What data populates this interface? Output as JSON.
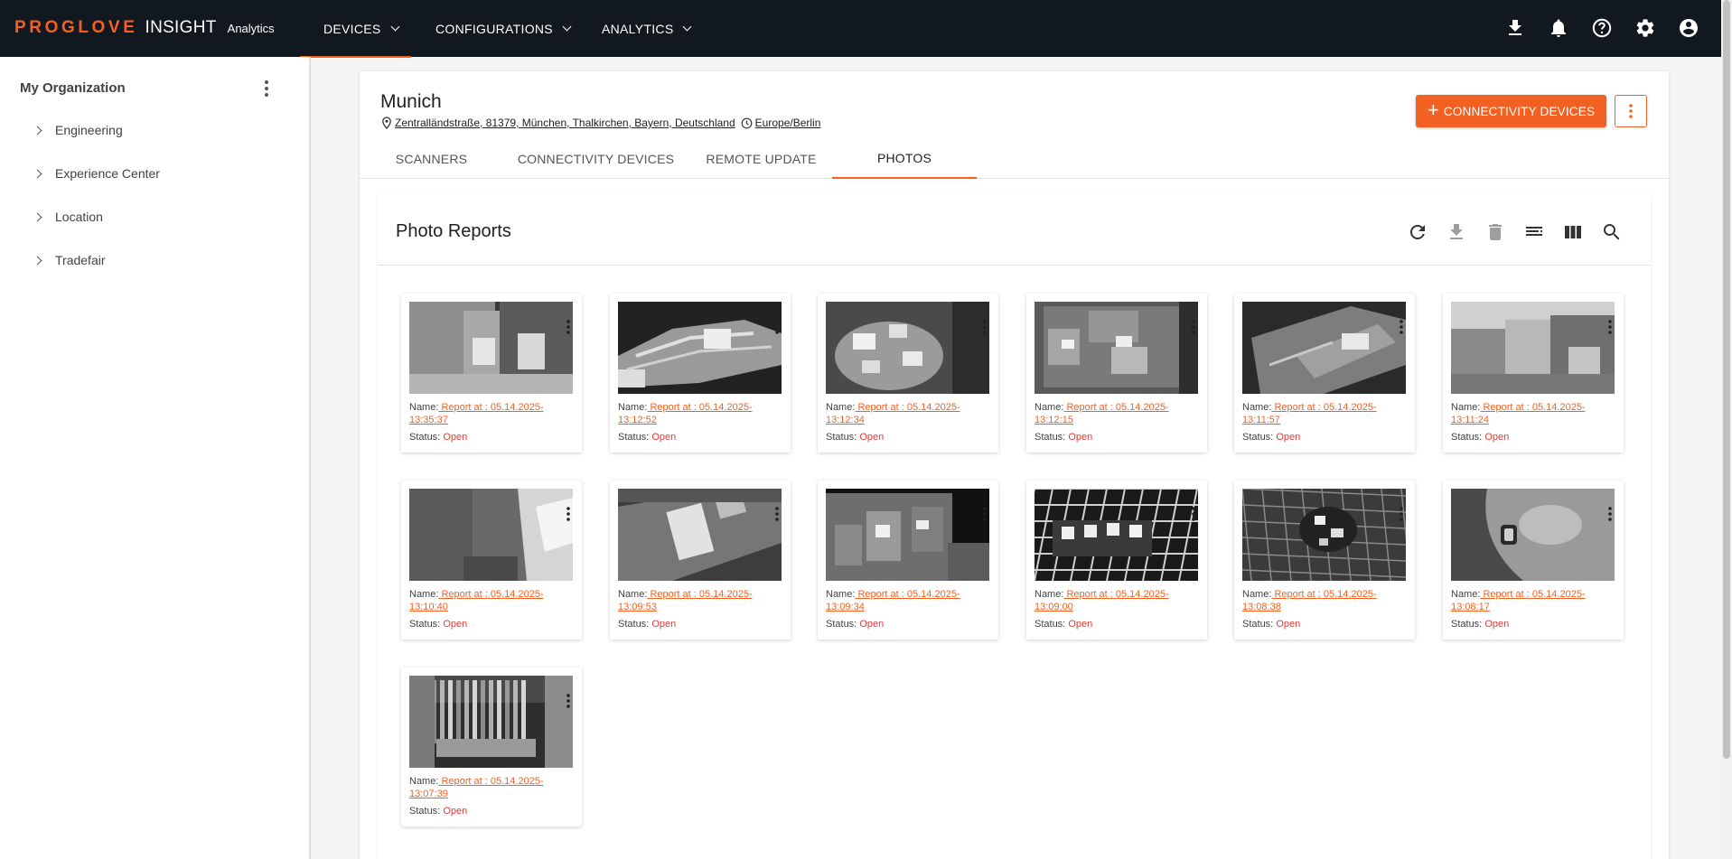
{
  "brand": {
    "primary": "PROGLOVE",
    "secondary": "INSIGHT",
    "product": "Analytics",
    "accent": "#f26122"
  },
  "nav": [
    {
      "label": "DEVICES"
    },
    {
      "label": "CONFIGURATIONS"
    },
    {
      "label": "ANALYTICS"
    }
  ],
  "toolbar_icons": [
    "download-icon",
    "bell-icon",
    "help-icon",
    "gear-icon",
    "account-icon"
  ],
  "sidebar": {
    "title": "My Organization",
    "items": [
      {
        "label": "Engineering"
      },
      {
        "label": "Experience Center"
      },
      {
        "label": "Location"
      },
      {
        "label": "Tradefair"
      }
    ]
  },
  "location": {
    "name": "Munich",
    "address": "Zentralländstraße, 81379, München, Thalkirchen, Bayern, Deutschland",
    "timezone": "Europe/Berlin"
  },
  "actions": {
    "add_label": "CONNECTIVITY DEVICES"
  },
  "tabs": [
    {
      "label": "SCANNERS"
    },
    {
      "label": "CONNECTIVITY DEVICES"
    },
    {
      "label": "REMOTE UPDATE"
    },
    {
      "label": "PHOTOS",
      "active": true
    }
  ],
  "panel": {
    "title": "Photo Reports",
    "icons": [
      "refresh-icon",
      "download-icon",
      "delete-icon",
      "filter-list-icon",
      "columns-icon",
      "search-icon"
    ]
  },
  "labels": {
    "name": "Name:",
    "status": "Status:"
  },
  "photos": [
    {
      "name": " Report at : 05.14.2025-13:35:37",
      "status": "Open"
    },
    {
      "name": " Report at : 05.14.2025-13:12:52",
      "status": "Open"
    },
    {
      "name": " Report at : 05.14.2025-13:12:34",
      "status": "Open"
    },
    {
      "name": " Report at : 05.14.2025-13:12:15",
      "status": "Open"
    },
    {
      "name": " Report at : 05.14.2025-13:11:57",
      "status": "Open"
    },
    {
      "name": " Report at : 05.14.2025-13:11:24",
      "status": "Open"
    },
    {
      "name": " Report at : 05.14.2025-13:10:40",
      "status": "Open"
    },
    {
      "name": " Report at : 05.14.2025-13:09:53",
      "status": "Open"
    },
    {
      "name": " Report at : 05.14.2025-13:09:34",
      "status": "Open"
    },
    {
      "name": " Report at : 05.14.2025-13:09:00",
      "status": "Open"
    },
    {
      "name": " Report at : 05.14.2025-13:08:38",
      "status": "Open"
    },
    {
      "name": " Report at : 05.14.2025-13:08:17",
      "status": "Open"
    },
    {
      "name": " Report at : 05.14.2025-13:07:39",
      "status": "Open"
    }
  ]
}
